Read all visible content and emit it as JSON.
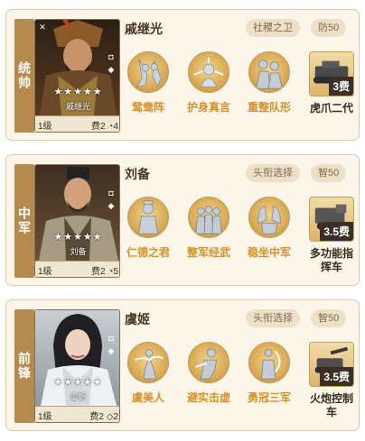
{
  "cards": [
    {
      "role": "统帅",
      "general": {
        "name": "戚继光",
        "portrait_name": "戚继光",
        "stars": "★★★★★",
        "level": "1级",
        "cost": "费2",
        "extra": "4"
      },
      "tag": "社稷之卫",
      "stat": "防50",
      "skills": [
        {
          "label": "鸳鸯阵",
          "icon": "warriors-icon"
        },
        {
          "label": "护身真言",
          "icon": "mystic-icon"
        },
        {
          "label": "重整队形",
          "icon": "troops-icon"
        }
      ],
      "gear": {
        "label_line1": "虎爪二代",
        "label_line2": "",
        "cost": "3费",
        "icon": "tank-icon"
      }
    },
    {
      "role": "中军",
      "general": {
        "name": "刘备",
        "portrait_name": "刘备",
        "stars": "★★★★★",
        "level": "1级",
        "cost": "费2",
        "extra": "5"
      },
      "tag": "头衔选择",
      "stat": "智50",
      "skills": [
        {
          "label": "仁德之君",
          "icon": "statue-icon"
        },
        {
          "label": "整军经武",
          "icon": "soldiers-icon"
        },
        {
          "label": "稳坐中军",
          "icon": "hands-icon"
        }
      ],
      "gear": {
        "label_line1": "多功能指",
        "label_line2": "挥车",
        "cost": "3.5费",
        "icon": "command-vehicle-icon"
      }
    },
    {
      "role": "前锋",
      "general": {
        "name": "虞姬",
        "portrait_name": "虞姬",
        "stars": "★★★★★",
        "level": "1级",
        "cost": "费2",
        "extra": "2"
      },
      "tag": "头衔选择",
      "stat": "智50",
      "skills": [
        {
          "label": "虞美人",
          "icon": "dancer-icon"
        },
        {
          "label": "避实击虚",
          "icon": "duel-icon"
        },
        {
          "label": "勇冠三军",
          "icon": "archer-icon"
        }
      ],
      "gear": {
        "label_line1": "火炮控制",
        "label_line2": "车",
        "cost": "3.5费",
        "icon": "artillery-icon"
      }
    }
  ],
  "colors": {
    "accent": "#d4922a",
    "role_bar": "#b48a4f",
    "card_bg": "#fbf5ea"
  }
}
